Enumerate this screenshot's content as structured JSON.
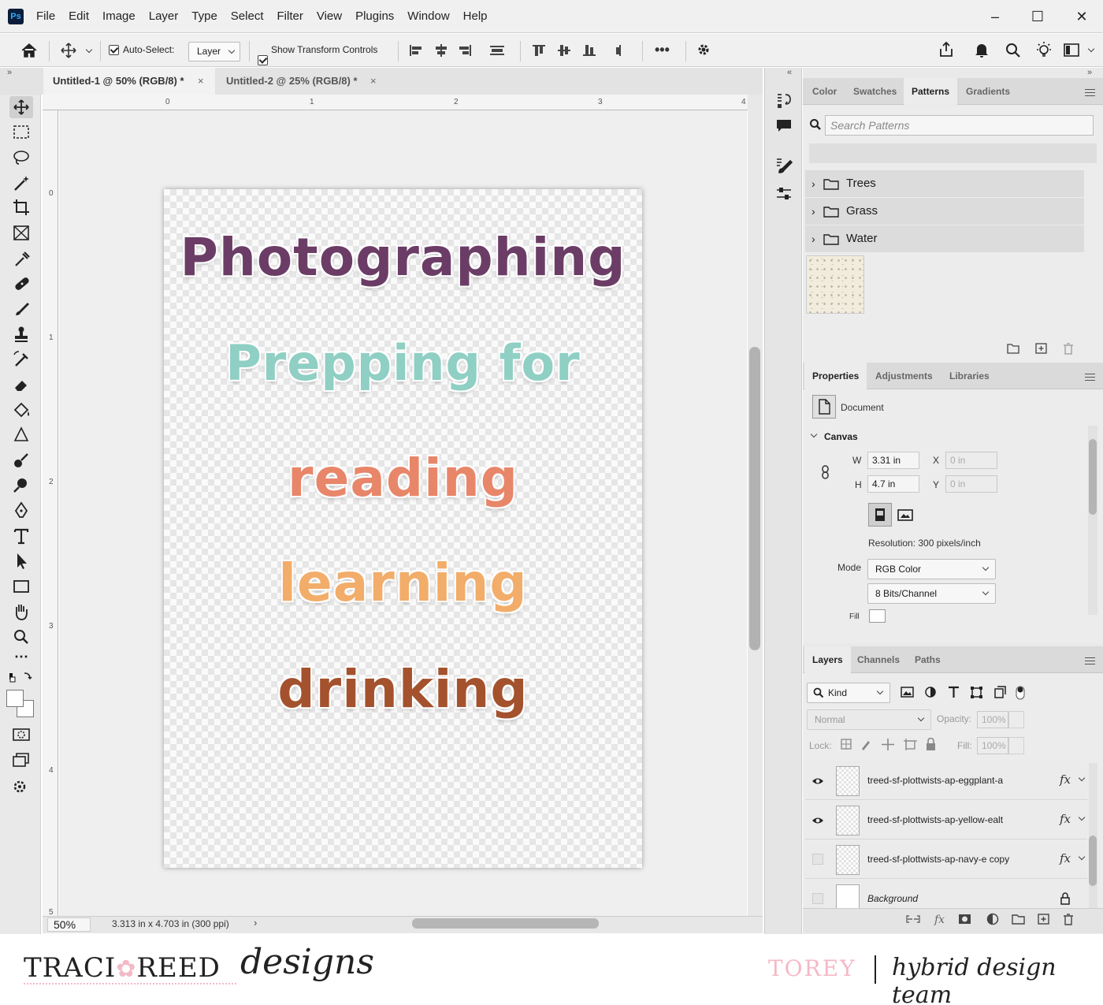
{
  "app": {
    "logo": "Ps",
    "menus": [
      "File",
      "Edit",
      "Image",
      "Layer",
      "Type",
      "Select",
      "Filter",
      "View",
      "Plugins",
      "Window",
      "Help"
    ]
  },
  "options_bar": {
    "auto_select_label": "Auto-Select:",
    "auto_select_value": "Layer",
    "show_transform_label": "Show Transform Controls"
  },
  "documents": {
    "tabs": [
      {
        "label": "Untitled-1 @ 50% (RGB/8) *",
        "active": true
      },
      {
        "label": "Untitled-2 @ 25% (RGB/8) *",
        "active": false
      }
    ]
  },
  "ruler": {
    "top_labels": [
      "0",
      "1",
      "2",
      "3",
      "4"
    ],
    "left_labels": [
      "0",
      "1",
      "2",
      "3",
      "4",
      "5"
    ]
  },
  "canvas": {
    "words": [
      {
        "text": "Photographing",
        "color": "#6b3d66"
      },
      {
        "text": "Prepping for",
        "color": "#8fcfc4"
      },
      {
        "text": "reading",
        "color": "#e8866a"
      },
      {
        "text": "learning",
        "color": "#f2ad6a"
      },
      {
        "text": "drinking",
        "color": "#a4522e"
      }
    ]
  },
  "status": {
    "zoom": "50%",
    "doc_info": "3.313 in x 4.703 in (300 ppi)"
  },
  "patterns_panel": {
    "tabs": [
      "Color",
      "Swatches",
      "Patterns",
      "Gradients"
    ],
    "active_tab": "Patterns",
    "search_placeholder": "Search Patterns",
    "folders": [
      "Trees",
      "Grass",
      "Water"
    ]
  },
  "properties_panel": {
    "tabs": [
      "Properties",
      "Adjustments",
      "Libraries"
    ],
    "active_tab": "Properties",
    "doc_label": "Document",
    "section": "Canvas",
    "w_label": "W",
    "w_value": "3.31 in",
    "h_label": "H",
    "h_value": "4.7 in",
    "x_label": "X",
    "x_value": "0 in",
    "y_label": "Y",
    "y_value": "0 in",
    "resolution": "Resolution: 300 pixels/inch",
    "mode_label": "Mode",
    "mode_value": "RGB Color",
    "bits_value": "8 Bits/Channel",
    "fill_label": "Fill"
  },
  "layers_panel": {
    "tabs": [
      "Layers",
      "Channels",
      "Paths"
    ],
    "active_tab": "Layers",
    "kind_label": "Kind",
    "blend_mode": "Normal",
    "opacity_label": "Opacity:",
    "opacity_value": "100%",
    "lock_label": "Lock:",
    "fill_label": "Fill:",
    "fill_value": "100%",
    "layers": [
      {
        "name": "treed-sf-plottwists-ap-eggplant-a",
        "visible": true,
        "fx": "fx"
      },
      {
        "name": "treed-sf-plottwists-ap-yellow-ealt",
        "visible": true,
        "fx": "fx"
      },
      {
        "name": "treed-sf-plottwists-ap-navy-e copy",
        "visible": false,
        "fx": "fx"
      },
      {
        "name": "Background",
        "visible": false,
        "fx": ""
      }
    ]
  },
  "footer": {
    "brand_left": "TRACI",
    "brand_mid": "REED",
    "brand_script": "designs",
    "designer": "TOREY",
    "team": "hybrid design team",
    "accent_color": "#f4b9c6"
  }
}
